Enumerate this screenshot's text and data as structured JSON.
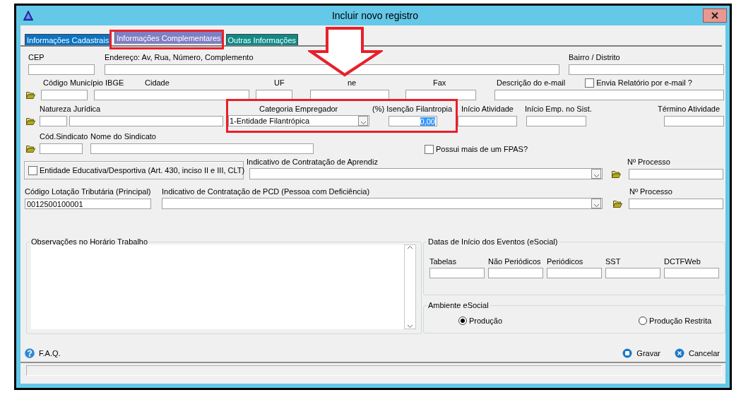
{
  "window": {
    "title": "Incluir novo registro"
  },
  "tabs": [
    {
      "label": "Informações Cadastrais",
      "selected": false,
      "color": "#0a74c4"
    },
    {
      "label": "Informações Complementares",
      "selected": true,
      "color": "#7f7fc4"
    },
    {
      "label": "Outras Informações",
      "selected": false,
      "color": "#0f8a86"
    }
  ],
  "rows": [
    {
      "items": [
        {
          "kind": "text",
          "label": "CEP"
        },
        {
          "kind": "text",
          "label": "Endereço: Av, Rua, Número, Complemento"
        },
        {
          "kind": "text",
          "label": "Bairro / Distrito"
        }
      ]
    },
    {
      "items": [
        {
          "kind": "folder"
        },
        {
          "kind": "text",
          "label": "Código Município IBGE"
        },
        {
          "kind": "text",
          "label": "Cidade"
        },
        {
          "kind": "text",
          "label": "UF"
        },
        {
          "kind": "text",
          "label": "ne"
        },
        {
          "kind": "text",
          "label": "Fax"
        },
        {
          "kind": "text",
          "label": "Descrição do e-mail",
          "check": {
            "label": "Envia Relatório por e-mail ?",
            "checked": false
          }
        }
      ]
    },
    {
      "items": [
        {
          "kind": "folder"
        },
        {
          "kind": "text",
          "label": "Natureza Jurídica"
        },
        {
          "kind": "text"
        },
        {
          "kind": "combo",
          "label": "Categoria Empregador",
          "value": "1-Entidade Filantrópica"
        },
        {
          "kind": "text",
          "label": "(%) Isenção Filantropia",
          "value": "0,00",
          "value_selected": true
        },
        {
          "kind": "text",
          "label": "Início Atividade"
        },
        {
          "kind": "text",
          "label": "Início Emp. no Sist."
        },
        {
          "kind": "text",
          "label": "Término Atividade"
        }
      ]
    },
    {
      "items": [
        {
          "kind": "folder"
        },
        {
          "kind": "text",
          "label": "Cód.Sindicato"
        },
        {
          "kind": "text",
          "label": "Nome do Sindicato"
        },
        {
          "kind": "check",
          "label": "Possui mais de um FPAS?",
          "checked": false
        }
      ]
    },
    {
      "items": [
        {
          "kind": "group_check",
          "label": "Entidade Educativa/Desportiva (Art. 430, inciso II e III, CLT)",
          "checked": false
        },
        {
          "kind": "combo",
          "label": "Indicativo de Contratação de Aprendiz"
        },
        {
          "kind": "folder"
        },
        {
          "kind": "text",
          "label": "Nº Processo"
        }
      ]
    },
    {
      "items": [
        {
          "kind": "text",
          "label": "Código Lotação Tributária (Principal)",
          "value": "0012500100001"
        },
        {
          "kind": "combo",
          "label": "Indicativo de Contratação de PCD (Pessoa com Deficiência)"
        },
        {
          "kind": "folder"
        },
        {
          "kind": "text",
          "label": "Nº Processo"
        }
      ]
    }
  ],
  "notes": {
    "legend": "Observações no Horário Trabalho"
  },
  "event_dates": {
    "legend": "Datas de Início dos Eventos (eSocial)",
    "fields": [
      {
        "label": "Tabelas"
      },
      {
        "label": "Não Periódicos"
      },
      {
        "label": "Periódicos"
      },
      {
        "label": "SST"
      },
      {
        "label": "DCTFWeb"
      }
    ]
  },
  "environment": {
    "legend": "Ambiente eSocial",
    "options": [
      {
        "label": "Produção",
        "selected": true
      },
      {
        "label": "Produção Restrita",
        "selected": false
      }
    ]
  },
  "footer": {
    "help": "F.A.Q.",
    "buttons": [
      {
        "kind": "save",
        "label": "Gravar"
      },
      {
        "kind": "cancel",
        "label": "Cancelar"
      }
    ]
  }
}
